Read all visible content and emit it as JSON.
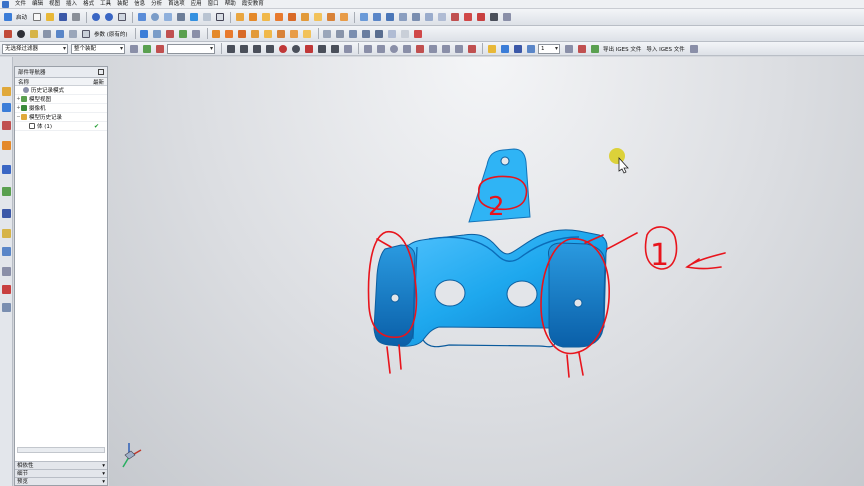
{
  "menu": [
    "文件",
    "编辑",
    "视图",
    "插入",
    "格式",
    "工具",
    "装配",
    "信息",
    "分析",
    "首选项",
    "应用",
    "窗口",
    "帮助",
    "霞安教育"
  ],
  "toolbar1": {
    "start_label": "启动"
  },
  "toolbar2": {
    "params_label": "参数 (原有的)"
  },
  "toolbar3": {
    "filter_value": "无选择过滤器",
    "assembly_value": "整个装配",
    "layer_value": "1",
    "export_iges": "导出 IGES 文件",
    "import_iges": "导入 IGES 文件"
  },
  "navigator": {
    "title": "部件导航器",
    "col_name": "名称",
    "col_latest": "最新",
    "rows": [
      {
        "label": "历史记录模式",
        "indent": 1,
        "toggle": ""
      },
      {
        "label": "模型视图",
        "indent": 0,
        "toggle": "+"
      },
      {
        "label": "摄像机",
        "indent": 0,
        "toggle": "+"
      },
      {
        "label": "模型历史记录",
        "indent": 0,
        "toggle": "−"
      },
      {
        "label": "体 (1)",
        "indent": 1,
        "toggle": "",
        "check": "✔"
      }
    ],
    "sections": [
      "相依性",
      "细节",
      "预览"
    ]
  },
  "annotations": [
    "2",
    "1"
  ],
  "colors": {
    "part": "#1ea8ee",
    "markup": "#e8141c",
    "cursor": "#d9cc1a"
  }
}
